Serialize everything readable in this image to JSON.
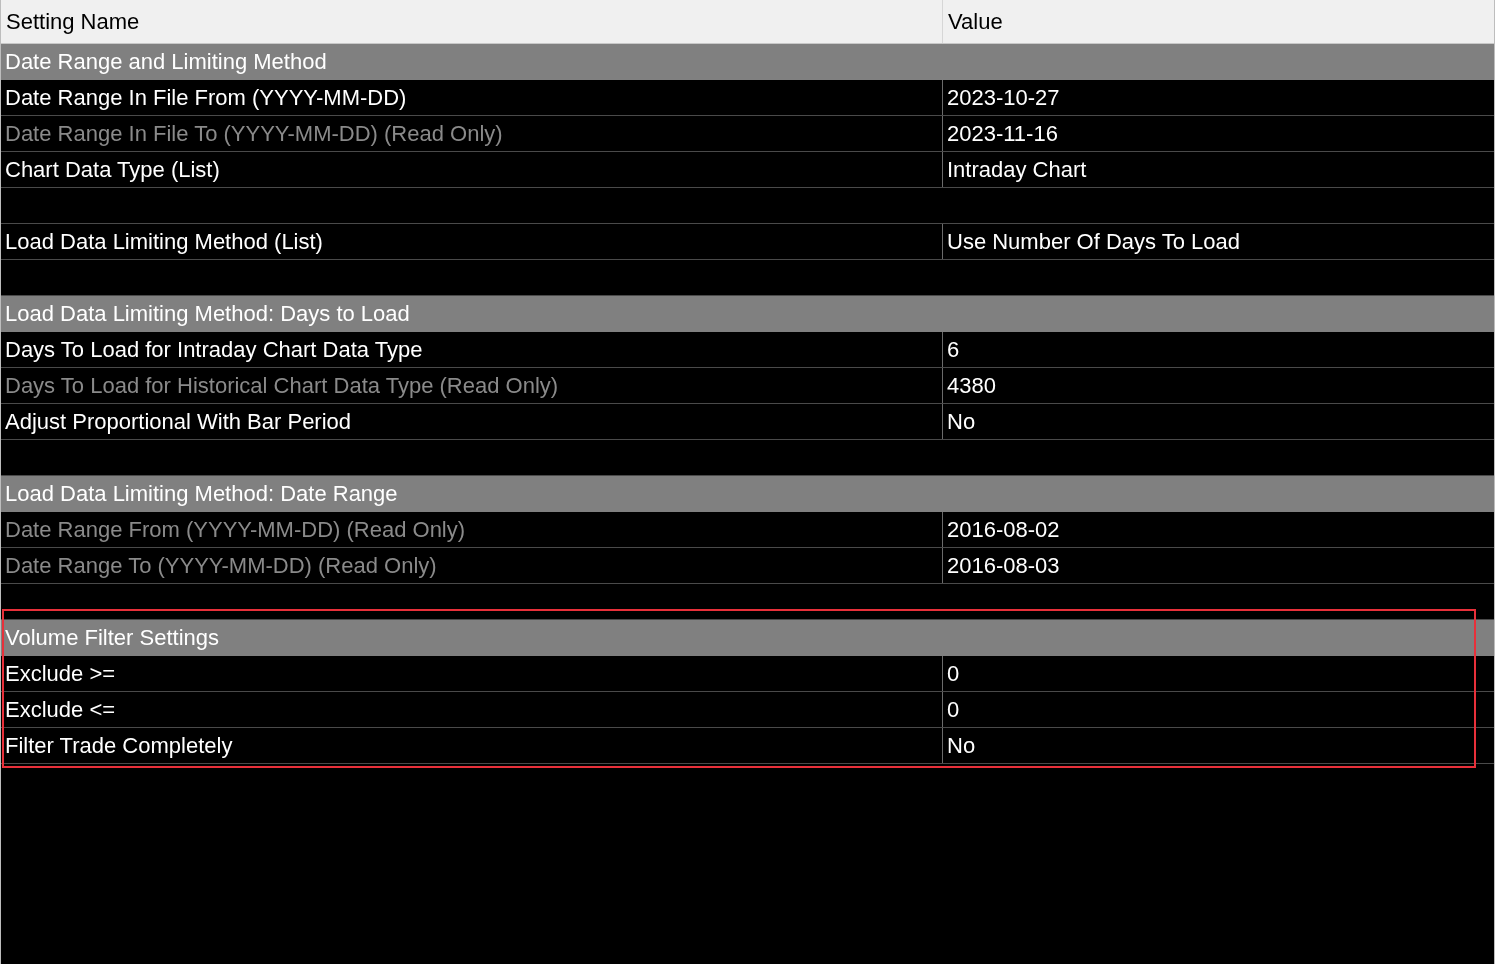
{
  "columns": [
    "Setting Name",
    "Value"
  ],
  "groups": [
    {
      "highlighted": false,
      "rows": [
        {
          "kind": "section",
          "name": "Date Range and Limiting Method"
        },
        {
          "kind": "setting",
          "name": "Date Range In File From (YYYY-MM-DD)",
          "value": "2023-10-27",
          "read_only": false
        },
        {
          "kind": "setting",
          "name": "Date Range In File To (YYYY-MM-DD) (Read Only)",
          "value": "2023-11-16",
          "read_only": true
        },
        {
          "kind": "setting",
          "name": "Chart Data Type (List)",
          "value": "Intraday Chart",
          "read_only": false
        },
        {
          "kind": "blank"
        },
        {
          "kind": "setting",
          "name": "Load Data Limiting Method (List)",
          "value": "Use Number Of Days To Load",
          "read_only": false
        },
        {
          "kind": "blank"
        }
      ]
    },
    {
      "highlighted": false,
      "rows": [
        {
          "kind": "section",
          "name": "Load Data Limiting Method: Days to Load"
        },
        {
          "kind": "setting",
          "name": "Days To Load for Intraday Chart Data Type",
          "value": "6",
          "read_only": false
        },
        {
          "kind": "setting",
          "name": "Days To Load for Historical Chart Data Type (Read Only)",
          "value": "4380",
          "read_only": true
        },
        {
          "kind": "setting",
          "name": "Adjust Proportional With Bar Period",
          "value": "No",
          "read_only": false
        },
        {
          "kind": "blank"
        }
      ]
    },
    {
      "highlighted": false,
      "rows": [
        {
          "kind": "section",
          "name": "Load Data Limiting Method: Date Range"
        },
        {
          "kind": "setting",
          "name": "Date Range From (YYYY-MM-DD) (Read Only)",
          "value": "2016-08-02",
          "read_only": true
        },
        {
          "kind": "setting",
          "name": "Date Range To (YYYY-MM-DD) (Read Only)",
          "value": "2016-08-03",
          "read_only": true
        },
        {
          "kind": "blank"
        }
      ]
    },
    {
      "highlighted": true,
      "rows": [
        {
          "kind": "section",
          "name": "Volume Filter Settings"
        },
        {
          "kind": "setting",
          "name": "Exclude >=",
          "value": "0",
          "read_only": false
        },
        {
          "kind": "setting",
          "name": "Exclude <=",
          "value": "0",
          "read_only": false
        },
        {
          "kind": "setting",
          "name": "Filter Trade Completely",
          "value": "No",
          "read_only": false
        }
      ]
    }
  ]
}
